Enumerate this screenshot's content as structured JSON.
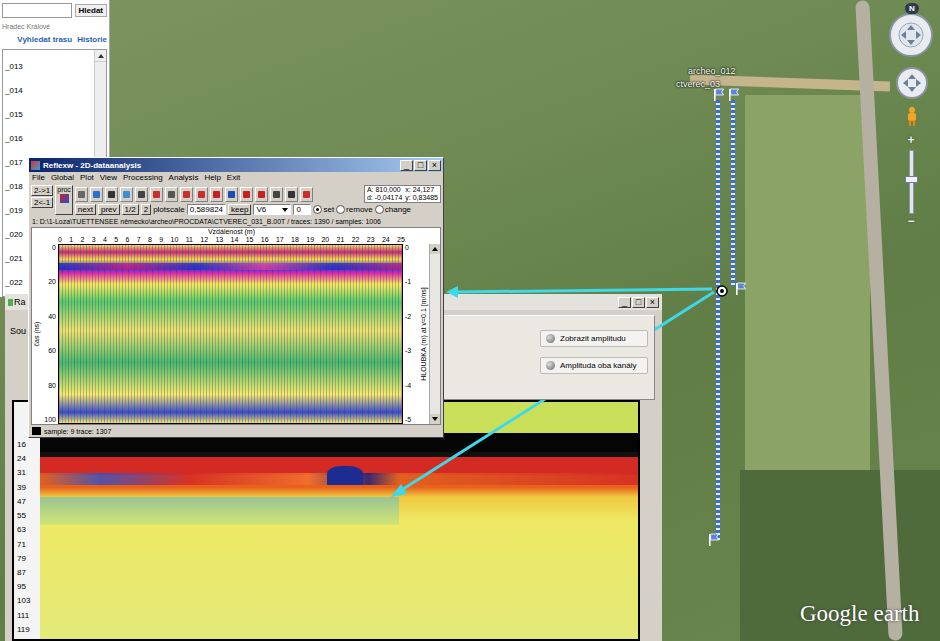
{
  "sidebar": {
    "search_button": "Hledat",
    "place": "Hradec Králové",
    "links": [
      "Vyhledat trasu",
      "Historie"
    ],
    "items": [
      "_013",
      "_014",
      "_015",
      "_016",
      "_017",
      "_018",
      "_019",
      "_020",
      "_021",
      "_022"
    ]
  },
  "reflexw": {
    "title": "Reflexw - 2D-dataanalysis",
    "window_controls": [
      "_",
      "□",
      "×"
    ],
    "menu": [
      "File",
      "Global",
      "Plot",
      "View",
      "Processing",
      "Analysis",
      "Help",
      "Exit"
    ],
    "toolbar": {
      "swap": [
        "2->1",
        "2<-1"
      ],
      "proc": "proc",
      "nav": [
        "next",
        "prev",
        "1/2",
        "2"
      ],
      "plotscale_label": "plotscale",
      "plotscale": "0,589824",
      "keep": "keep",
      "layer": "V6",
      "value": "0",
      "radios": [
        {
          "label": "set",
          "selected": true
        },
        {
          "label": "remove",
          "selected": false
        },
        {
          "label": "change",
          "selected": false
        }
      ],
      "readout": [
        "A: 810,000",
        "x: 24,127",
        "d: -0,04174",
        "y: 0,83485"
      ]
    },
    "path": "1: D:\\1-Loza\\TUETTENSEE německo\\archeo\\PROCDATA\\CTVEREC_031_B.00T / traces: 1390 / samples: 1006",
    "plot": {
      "x_title": "Vzdálenost (m)",
      "x_ticks": [
        "0",
        "1",
        "2",
        "3",
        "4",
        "5",
        "6",
        "7",
        "8",
        "9",
        "10",
        "11",
        "12",
        "13",
        "14",
        "15",
        "16",
        "17",
        "18",
        "19",
        "20",
        "21",
        "22",
        "23",
        "24",
        "25"
      ],
      "y_title": "čas (ns)",
      "y_ticks": [
        "0",
        "20",
        "40",
        "60",
        "80",
        "100"
      ],
      "right_title": "HLOUBKA (m) at v=0.1 [m/ns]",
      "right_ticks": [
        "0",
        "-1",
        "-2",
        "-3",
        "-4",
        "-5"
      ]
    },
    "status": "sample: 9 trace: 1307"
  },
  "amplitude_window": {
    "tab": "Ra",
    "label": "Sou",
    "window_controls": [
      "_",
      "□",
      "×"
    ],
    "buttons": [
      "Zobrazit amplitudu",
      "Amplituda oba kanály"
    ],
    "radargram": {
      "y_ticks": [
        "16",
        "24",
        "31",
        "39",
        "47",
        "55",
        "63",
        "71",
        "79",
        "87",
        "95",
        "103",
        "111",
        "119"
      ]
    }
  },
  "map": {
    "labels": [
      "archeo_012",
      "ctverec_03"
    ],
    "compass": "N",
    "zoom_in": "+",
    "zoom_out": "−",
    "logo": "Google earth"
  }
}
